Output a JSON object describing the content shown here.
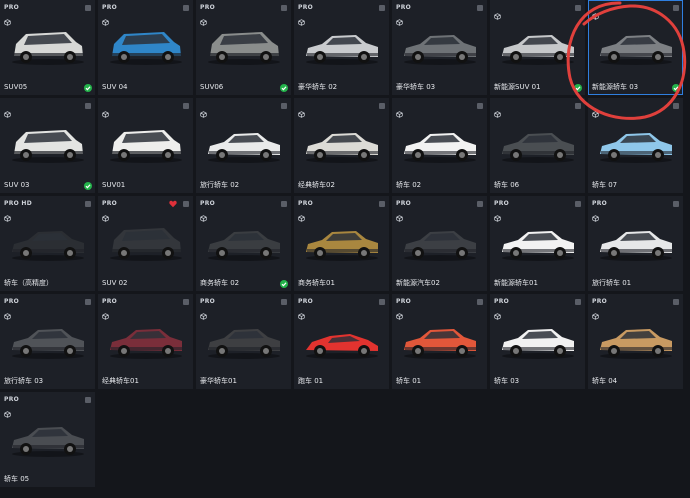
{
  "colors": {
    "background": "#14161b",
    "tile": "#1d2027",
    "selection": "#2f7fe0",
    "check_ok": "#24b34b",
    "favorite": "#e0303a",
    "annotation": "#e0403c"
  },
  "icons": {
    "model": "cube-icon",
    "select": "checkbox-icon",
    "ok": "check-circle-icon",
    "favorite": "heart-icon"
  },
  "tiles": [
    {
      "label": "SUV05",
      "badge": "PRO",
      "status": "ok",
      "car_color": "#d7d8d6",
      "shape": "suv"
    },
    {
      "label": "SUV 04",
      "badge": "PRO",
      "status": "",
      "car_color": "#2f86c8",
      "shape": "suv"
    },
    {
      "label": "SUV06",
      "badge": "PRO",
      "status": "ok",
      "car_color": "#8a8d8c",
      "shape": "suv"
    },
    {
      "label": "豪华轿车 02",
      "badge": "PRO",
      "status": "",
      "car_color": "#c9cbce",
      "shape": "sedan"
    },
    {
      "label": "豪华轿车 03",
      "badge": "PRO",
      "status": "",
      "car_color": "#6e7276",
      "shape": "sedan"
    },
    {
      "label": "新能源SUV 01",
      "badge": "",
      "status": "ok",
      "car_color": "#c6c8ca",
      "shape": "sedan"
    },
    {
      "label": "新能源轿车 03",
      "badge": "",
      "status": "ok",
      "car_color": "#7d8084",
      "shape": "sedan",
      "selected": true
    },
    {
      "label": "SUV 03",
      "badge": "",
      "status": "ok",
      "car_color": "#e3e4e2",
      "shape": "suv"
    },
    {
      "label": "SUV01",
      "badge": "",
      "status": "",
      "car_color": "#eeeeec",
      "shape": "suv"
    },
    {
      "label": "旅行轿车 02",
      "badge": "",
      "status": "",
      "car_color": "#e9eaea",
      "shape": "sedan"
    },
    {
      "label": "经典轿车02",
      "badge": "",
      "status": "",
      "car_color": "#dcdbd6",
      "shape": "sedan"
    },
    {
      "label": "轿车 02",
      "badge": "",
      "status": "",
      "car_color": "#f2f2f2",
      "shape": "sedan"
    },
    {
      "label": "轿车 06",
      "badge": "",
      "status": "",
      "car_color": "#4a4e52",
      "shape": "sedan"
    },
    {
      "label": "轿车 07",
      "badge": "",
      "status": "",
      "car_color": "#8fc7ea",
      "shape": "sedan"
    },
    {
      "label": "轿车（高精度）",
      "badge": "PRO HD",
      "status": "",
      "car_color": "#2b2e33",
      "shape": "sedan"
    },
    {
      "label": "SUV 02",
      "badge": "PRO",
      "status": "fav",
      "car_color": "#33363b",
      "shape": "suv"
    },
    {
      "label": "商务轿车 02",
      "badge": "PRO",
      "status": "ok",
      "car_color": "#3a3d41",
      "shape": "sedan"
    },
    {
      "label": "商务轿车01",
      "badge": "PRO",
      "status": "",
      "car_color": "#a9873f",
      "shape": "sedan"
    },
    {
      "label": "新能源汽车02",
      "badge": "PRO",
      "status": "",
      "car_color": "#3c3f44",
      "shape": "sedan"
    },
    {
      "label": "新能源轿车01",
      "badge": "PRO",
      "status": "",
      "car_color": "#f2f2f2",
      "shape": "sedan"
    },
    {
      "label": "旅行轿车 01",
      "badge": "PRO",
      "status": "",
      "car_color": "#e6e7e8",
      "shape": "sedan"
    },
    {
      "label": "旅行轿车 03",
      "badge": "PRO",
      "status": "",
      "car_color": "#505358",
      "shape": "sedan"
    },
    {
      "label": "经典轿车01",
      "badge": "PRO",
      "status": "",
      "car_color": "#7a2e3a",
      "shape": "sedan"
    },
    {
      "label": "豪华轿车01",
      "badge": "PRO",
      "status": "",
      "car_color": "#3e3f42",
      "shape": "sedan"
    },
    {
      "label": "跑车 01",
      "badge": "PRO",
      "status": "",
      "car_color": "#e2332f",
      "shape": "sport"
    },
    {
      "label": "轿车 01",
      "badge": "PRO",
      "status": "",
      "car_color": "#e2573a",
      "shape": "sedan"
    },
    {
      "label": "轿车 03",
      "badge": "PRO",
      "status": "",
      "car_color": "#f1f1f1",
      "shape": "sedan"
    },
    {
      "label": "轿车 04",
      "badge": "PRO",
      "status": "",
      "car_color": "#c89a62",
      "shape": "sedan"
    },
    {
      "label": "轿车 05",
      "badge": "PRO",
      "status": "",
      "car_color": "#4a4d52",
      "shape": "sedan"
    }
  ]
}
